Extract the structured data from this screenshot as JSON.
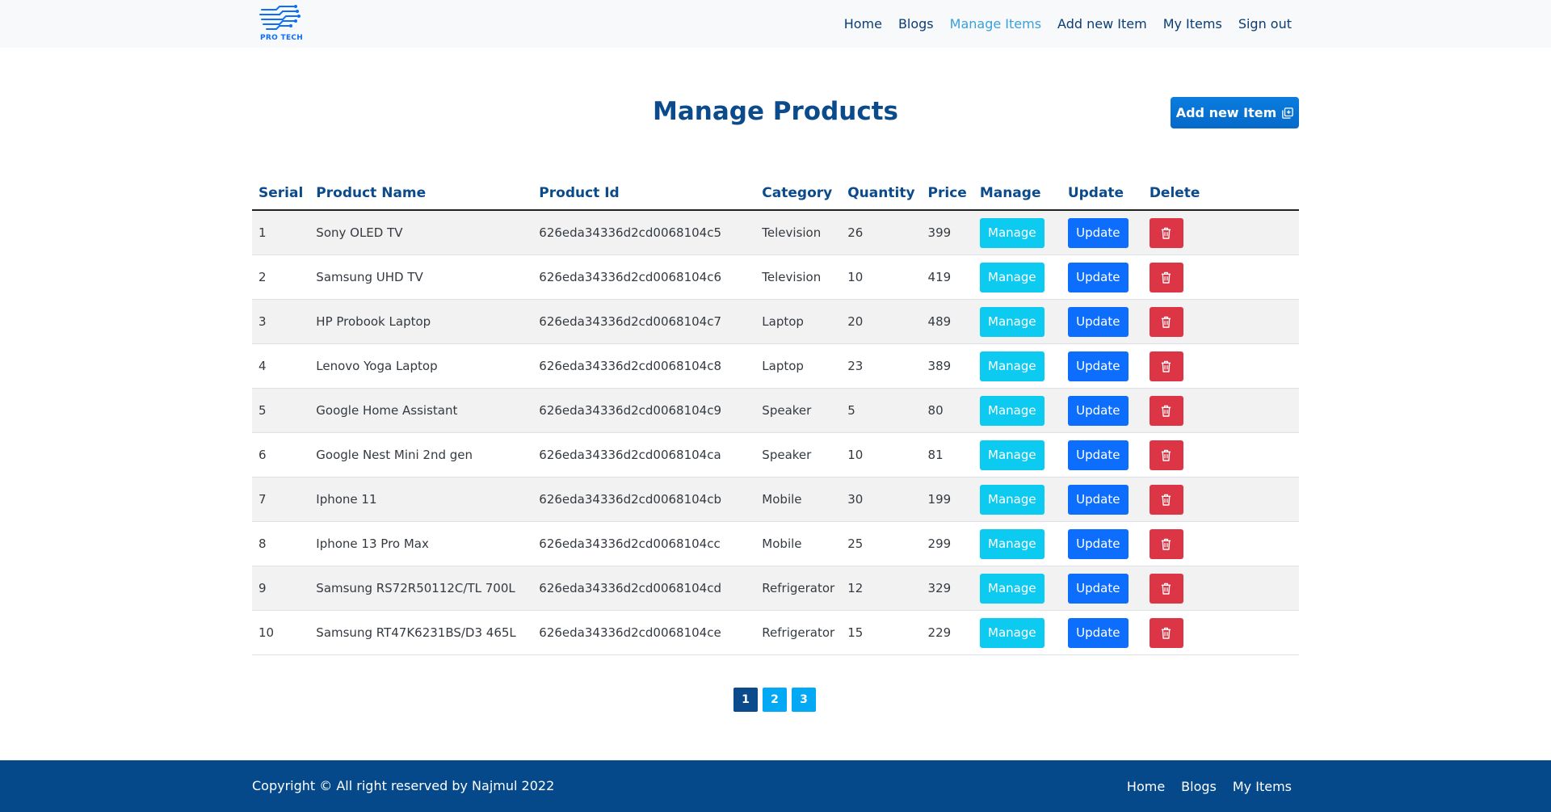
{
  "brand": {
    "logo_text": "PRO TECH",
    "color": "#0d6efd"
  },
  "nav": {
    "links": [
      {
        "label": "Home"
      },
      {
        "label": "Blogs"
      },
      {
        "label": "Manage Items",
        "active": true
      },
      {
        "label": "Add new Item"
      },
      {
        "label": "My Items"
      },
      {
        "label": "Sign out"
      }
    ]
  },
  "page": {
    "title": "Manage Products",
    "add_button_label": "Add new Item"
  },
  "table": {
    "headers": [
      "Serial",
      "Product Name",
      "Product Id",
      "Category",
      "Quantity",
      "Price",
      "Manage",
      "Update",
      "Delete"
    ],
    "manage_label": "Manage",
    "update_label": "Update",
    "rows": [
      {
        "serial": "1",
        "name": "Sony OLED TV",
        "id": "626eda34336d2cd0068104c5",
        "category": "Television",
        "quantity": "26",
        "price": "399"
      },
      {
        "serial": "2",
        "name": "Samsung UHD TV",
        "id": "626eda34336d2cd0068104c6",
        "category": "Television",
        "quantity": "10",
        "price": "419"
      },
      {
        "serial": "3",
        "name": "HP Probook Laptop",
        "id": "626eda34336d2cd0068104c7",
        "category": "Laptop",
        "quantity": "20",
        "price": "489"
      },
      {
        "serial": "4",
        "name": "Lenovo Yoga Laptop",
        "id": "626eda34336d2cd0068104c8",
        "category": "Laptop",
        "quantity": "23",
        "price": "389"
      },
      {
        "serial": "5",
        "name": "Google Home Assistant",
        "id": "626eda34336d2cd0068104c9",
        "category": "Speaker",
        "quantity": "5",
        "price": "80"
      },
      {
        "serial": "6",
        "name": "Google Nest Mini 2nd gen",
        "id": "626eda34336d2cd0068104ca",
        "category": "Speaker",
        "quantity": "10",
        "price": "81"
      },
      {
        "serial": "7",
        "name": "Iphone 11",
        "id": "626eda34336d2cd0068104cb",
        "category": "Mobile",
        "quantity": "30",
        "price": "199"
      },
      {
        "serial": "8",
        "name": "Iphone 13 Pro Max",
        "id": "626eda34336d2cd0068104cc",
        "category": "Mobile",
        "quantity": "25",
        "price": "299"
      },
      {
        "serial": "9",
        "name": "Samsung RS72R50112C/TL 700L",
        "id": "626eda34336d2cd0068104cd",
        "category": "Refrigerator",
        "quantity": "12",
        "price": "329"
      },
      {
        "serial": "10",
        "name": "Samsung RT47K6231BS/D3 465L",
        "id": "626eda34336d2cd0068104ce",
        "category": "Refrigerator",
        "quantity": "15",
        "price": "229"
      }
    ]
  },
  "pagination": {
    "pages": [
      "1",
      "2",
      "3"
    ],
    "active": "1"
  },
  "footer": {
    "copyright": "Copyright © All right reserved by Najmul 2022",
    "links": [
      {
        "label": "Home"
      },
      {
        "label": "Blogs"
      },
      {
        "label": "My Items"
      }
    ]
  },
  "colors": {
    "primary": "#0d6efd",
    "info": "#0dcaf0",
    "danger": "#dc3545",
    "dark_blue": "#05498b",
    "pagination": "#03a9f4"
  }
}
